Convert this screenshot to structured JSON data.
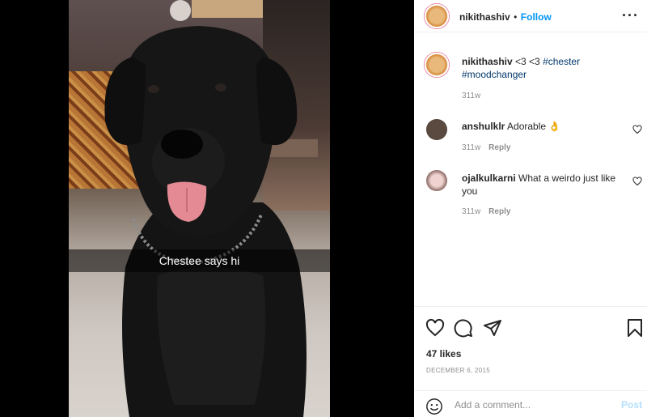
{
  "photo": {
    "overlay_caption": "Chestee says hi"
  },
  "post": {
    "username": "nikithashiv",
    "separator": "•",
    "follow_label": "Follow",
    "more_icon": "more-horizontal-icon",
    "caption_prefix": "<3 <3 ",
    "hashtag_1": "#chester",
    "hashtag_2": "#moodchanger",
    "caption_age": "311w"
  },
  "comments": [
    {
      "username": "anshulklr",
      "text": "Adorable 👌",
      "age": "311w",
      "reply_label": "Reply"
    },
    {
      "username": "ojalkulkarni",
      "text": "What a weirdo just like you",
      "age": "311w",
      "reply_label": "Reply"
    }
  ],
  "actions": {
    "likes": "47 likes",
    "date": "DECEMBER 6, 2015"
  },
  "comment_input": {
    "placeholder": "Add a comment...",
    "post_label": "Post"
  },
  "colors": {
    "link_blue": "#0095f6",
    "hashtag": "#00376b",
    "muted": "#8e8e8e",
    "post_disabled": "#b2dffc"
  }
}
